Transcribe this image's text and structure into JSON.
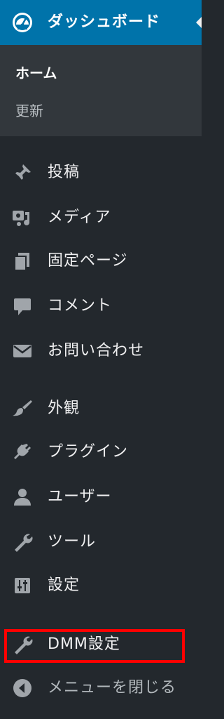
{
  "dashboard": {
    "label": "ダッシュボード",
    "icon": "dashboard-icon"
  },
  "submenu": {
    "home": "ホーム",
    "update": "更新"
  },
  "menu": {
    "posts": "投稿",
    "media": "メディア",
    "pages": "固定ページ",
    "comments": "コメント",
    "contact": "お問い合わせ",
    "appearance": "外観",
    "plugins": "プラグイン",
    "users": "ユーザー",
    "tools": "ツール",
    "settings": "設定",
    "dmm": "DMM設定",
    "collapse": "メニューを閉じる"
  },
  "colors": {
    "sidebar_bg": "#23282d",
    "active_bg": "#0073aa",
    "submenu_bg": "#32373c",
    "highlight": "#ff0000"
  }
}
